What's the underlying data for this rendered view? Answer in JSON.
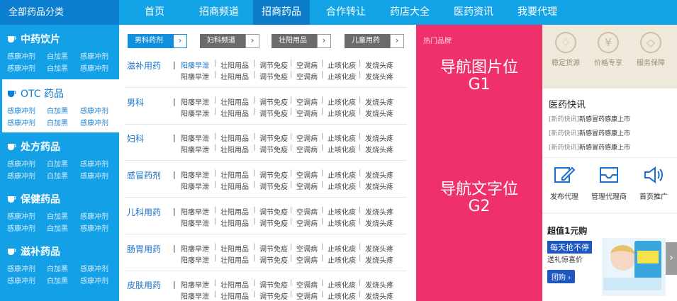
{
  "nav": {
    "all_categories": "全部药品分类",
    "items": [
      "首页",
      "招商频道",
      "招商药品",
      "合作转让",
      "药店大全",
      "医药资讯",
      "我要代理"
    ],
    "active_index": 2
  },
  "sidebar": {
    "categories": [
      {
        "title": "中药饮片",
        "subs": [
          "感康冲剂",
          "白加黑",
          "感康冲剂",
          "感康冲剂",
          "白加黑",
          "感康冲剂"
        ]
      },
      {
        "title": "OTC 药品",
        "subs": [
          "感康冲剂",
          "白加黑",
          "感康冲剂",
          "感康冲剂",
          "白加黑",
          "感康冲剂"
        ]
      },
      {
        "title": "处方药品",
        "subs": [
          "感康冲剂",
          "白加黑",
          "感康冲剂",
          "感康冲剂",
          "白加黑",
          "感康冲剂"
        ]
      },
      {
        "title": "保健药品",
        "subs": [
          "感康冲剂",
          "白加黑",
          "感康冲剂",
          "感康冲剂",
          "白加黑",
          "感康冲剂"
        ]
      },
      {
        "title": "滋补药品",
        "subs": [
          "感康冲剂",
          "白加黑",
          "感康冲剂",
          "感康冲剂",
          "白加黑",
          "感康冲剂"
        ]
      }
    ],
    "selected_index": 1
  },
  "tabs": [
    "男科药剂",
    "妇科频道",
    "壮阳用品",
    "儿童用药"
  ],
  "rows": [
    {
      "title": "滋补用药",
      "links": [
        [
          "阳痿早泄",
          "壮阳用品",
          "调节免疫",
          "空调病",
          "止咳化痰",
          "发烧头疼"
        ],
        [
          "阳痿早泄",
          "壮阳用品",
          "调节免疫",
          "空调病",
          "止咳化痰",
          "发烧头疼"
        ]
      ]
    },
    {
      "title": "男科",
      "links": [
        [
          "阳痿早泄",
          "壮阳用品",
          "调节免疫",
          "空调病",
          "止咳化痰",
          "发烧头疼"
        ],
        [
          "阳痿早泄",
          "壮阳用品",
          "调节免疫",
          "空调病",
          "止咳化痰",
          "发烧头疼"
        ]
      ]
    },
    {
      "title": "妇科",
      "links": [
        [
          "阳痿早泄",
          "壮阳用品",
          "调节免疫",
          "空调病",
          "止咳化痰",
          "发烧头疼"
        ],
        [
          "阳痿早泄",
          "壮阳用品",
          "调节免疫",
          "空调病",
          "止咳化痰",
          "发烧头疼"
        ]
      ]
    },
    {
      "title": "感冒药剂",
      "links": [
        [
          "阳痿早泄",
          "壮阳用品",
          "调节免疫",
          "空调病",
          "止咳化痰",
          "发烧头疼"
        ],
        [
          "阳痿早泄",
          "壮阳用品",
          "调节免疫",
          "空调病",
          "止咳化痰",
          "发烧头疼"
        ]
      ]
    },
    {
      "title": "儿科用药",
      "links": [
        [
          "阳痿早泄",
          "壮阳用品",
          "调节免疫",
          "空调病",
          "止咳化痰",
          "发烧头疼"
        ],
        [
          "阳痿早泄",
          "壮阳用品",
          "调节免疫",
          "空调病",
          "止咳化痰",
          "发烧头疼"
        ]
      ]
    },
    {
      "title": "肠胃用药",
      "links": [
        [
          "阳痿早泄",
          "壮阳用品",
          "调节免疫",
          "空调病",
          "止咳化痰",
          "发烧头疼"
        ],
        [
          "阳痿早泄",
          "壮阳用品",
          "调节免疫",
          "空调病",
          "止咳化痰",
          "发烧头疼"
        ]
      ]
    },
    {
      "title": "皮肤用药",
      "links": [
        [
          "阳痿早泄",
          "壮阳用品",
          "调节免疫",
          "空调病",
          "止咳化痰",
          "发烧头疼"
        ],
        [
          "阳痿早泄",
          "壮阳用品",
          "调节免疫",
          "空调病",
          "止咳化痰",
          "发烧头疼"
        ]
      ]
    }
  ],
  "promo": {
    "label": "热门品牌",
    "g1_line1": "导航图片位",
    "g1_line2": "G1",
    "g2_line1": "导航文字位",
    "g2_line2": "G2"
  },
  "services": [
    "稳定货源",
    "价格专享",
    "服务保障"
  ],
  "news": {
    "title": "医药快讯",
    "items": [
      {
        "tag": "[新药快讯]",
        "text": "新感冒药感康上市"
      },
      {
        "tag": "[新药快讯]",
        "text": "新感冒药感康上市"
      },
      {
        "tag": "[新药快讯]",
        "text": "新感冒药感康上市"
      }
    ]
  },
  "tools": [
    "发布代理",
    "管理代理商",
    "首页推广"
  ],
  "deal": {
    "title": "超值1元购",
    "badge": "每天抢不停",
    "sub": "送礼惊喜价",
    "button": "团购 ›"
  },
  "colors": {
    "nav": "#12a3e6",
    "sidebar": "#14a0e6",
    "promo": "#f0306a",
    "service_bg": "#efe9dc"
  }
}
